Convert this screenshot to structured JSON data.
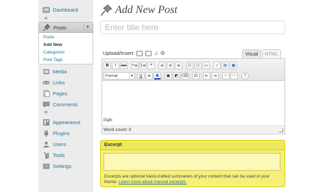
{
  "sidebar": {
    "dashboard": "Dashboard",
    "posts": {
      "label": "Posts",
      "toggle": "▼",
      "submenu": [
        "Posts",
        "Add New",
        "Categories",
        "Post Tags"
      ]
    },
    "media": "Media",
    "links": "Links",
    "pages": "Pages",
    "comments": "Comments",
    "appearance": "Appearance",
    "plugins": "Plugins",
    "users": "Users",
    "tools": "Tools",
    "settings": "Settings",
    "separator_glyph": "◀"
  },
  "main": {
    "page_title": "Add New Post",
    "title_placeholder": "Enter title here",
    "upload_insert": "Upload/Insert",
    "tabs": {
      "visual": "Visual",
      "html": "HTML"
    },
    "toolbar": {
      "row1": [
        "B",
        "I",
        "ABC",
        "•≡",
        "1≡",
        "❝",
        "≡",
        "≡",
        "≡",
        "⛓",
        "⛓",
        "▭",
        "✓",
        "▤",
        "▦"
      ],
      "format_select": "Format",
      "row2": [
        "U",
        "≡",
        "A",
        "▣",
        "◩",
        "⌫",
        "Ω",
        "⇤",
        "⇥",
        "↶",
        "↷",
        "?"
      ]
    },
    "path_label": "Path:",
    "word_count": "Word count: 0"
  },
  "excerpt": {
    "heading": "Excerpt",
    "help_text": "Excerpts are optional hand-crafted summaries of your content that can be used in your theme.",
    "help_link": "Learn more about manual excerpts."
  },
  "colors": {
    "link": "#21759b",
    "excerpt_highlight": "#f6ef7a",
    "sidebar_bg": "#ececec"
  }
}
